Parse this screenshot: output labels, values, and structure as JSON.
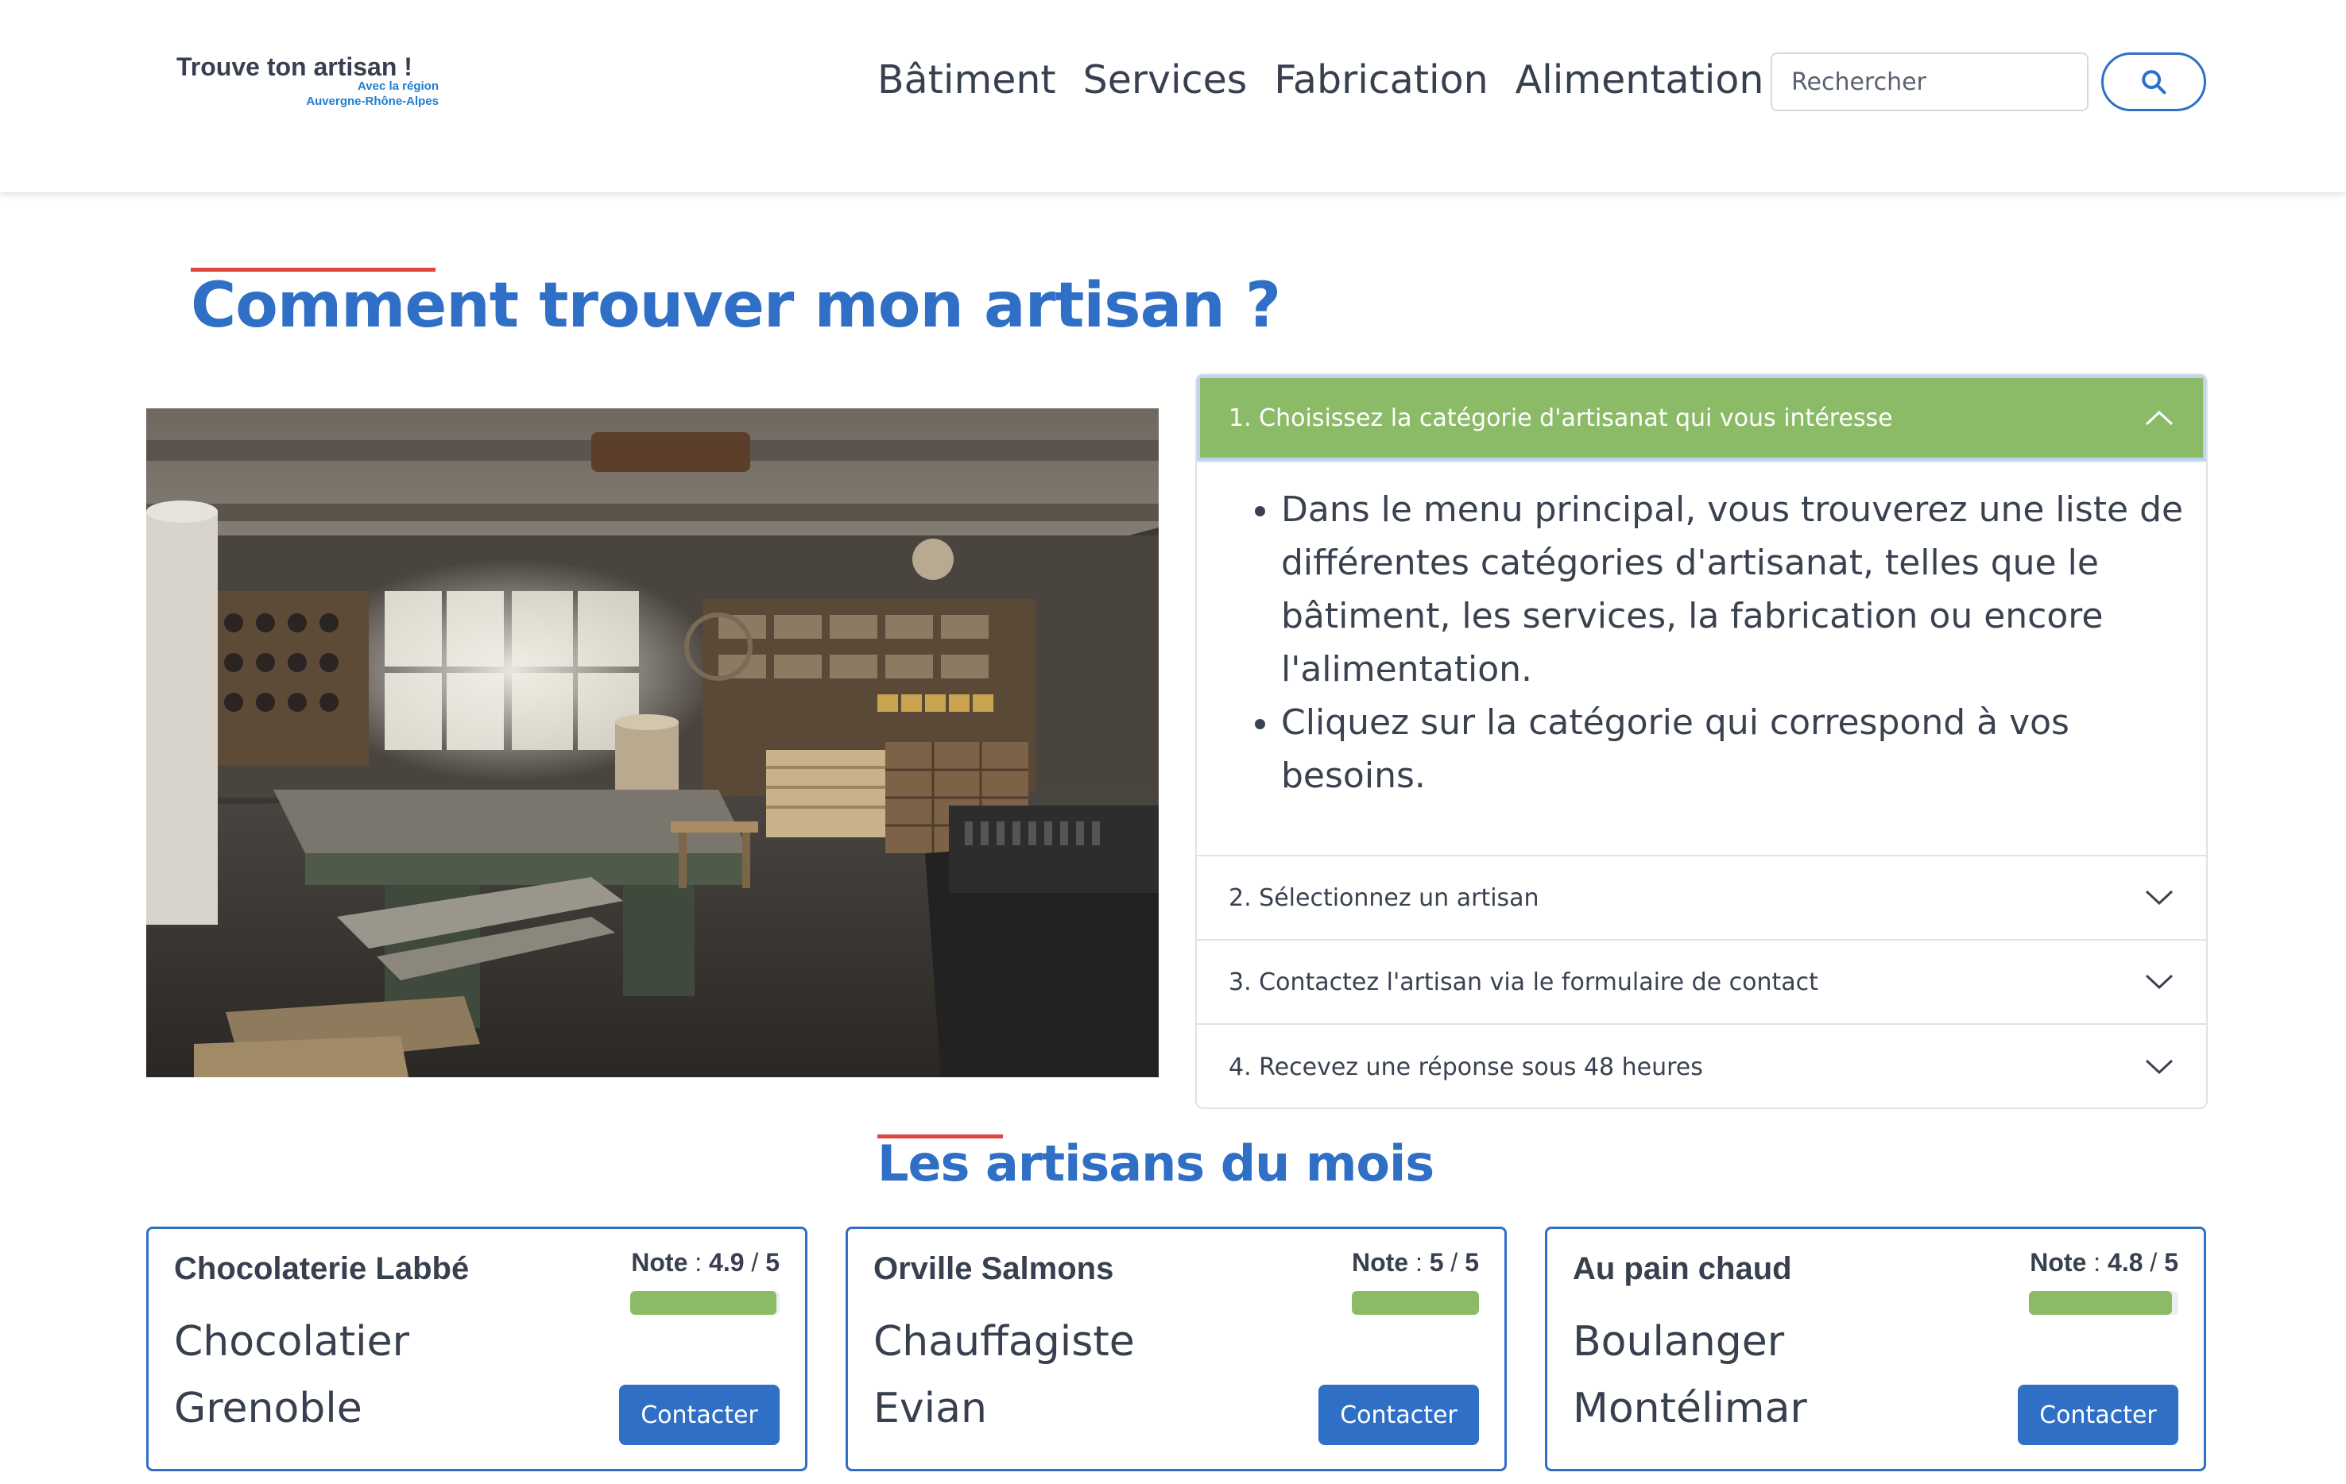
{
  "brand": {
    "title": "Trouve ton artisan !",
    "subtitle_line1": "Avec la région",
    "subtitle_line2": "Auvergne-Rhône-Alpes"
  },
  "nav": {
    "items": [
      "Bâtiment",
      "Services",
      "Fabrication",
      "Alimentation"
    ]
  },
  "search": {
    "placeholder": "Rechercher",
    "value": ""
  },
  "how_to": {
    "title": "Comment trouver mon artisan ?",
    "steps": [
      {
        "label": "1. Choisissez la catégorie d'artisanat qui vous intéresse",
        "expanded": true,
        "bullets": [
          "Dans le menu principal, vous trouverez une liste de différentes catégories d'artisanat, telles que le bâtiment, les services, la fabrication ou encore l'alimentation.",
          "Cliquez sur la catégorie qui correspond à vos besoins."
        ]
      },
      {
        "label": "2. Sélectionnez un artisan",
        "expanded": false
      },
      {
        "label": "3. Contactez l'artisan via le formulaire de contact",
        "expanded": false
      },
      {
        "label": "4. Recevez une réponse sous 48 heures",
        "expanded": false
      }
    ]
  },
  "artisans": {
    "title": "Les artisans du mois",
    "note_label": "Note",
    "contact_label": "Contacter",
    "cards": [
      {
        "name": "Chocolaterie Labbé",
        "job": "Chocolatier",
        "city": "Grenoble",
        "rating": "4.9",
        "rating_max": "5",
        "rating_fraction": 0.98
      },
      {
        "name": "Orville Salmons",
        "job": "Chauffagiste",
        "city": "Evian",
        "rating": "5",
        "rating_max": "5",
        "rating_fraction": 1.0
      },
      {
        "name": "Au pain chaud",
        "job": "Boulanger",
        "city": "Montélimar",
        "rating": "4.8",
        "rating_max": "5",
        "rating_fraction": 0.96
      }
    ]
  },
  "colors": {
    "accent_blue": "#2f6fc6",
    "accent_red": "#e2453d",
    "accordion_active_green": "#8cbb68",
    "rating_green": "#8cbb68"
  },
  "icons": {
    "search": "search-icon",
    "accordion_open": "chevron-up-icon",
    "accordion_closed": "chevron-down-icon"
  }
}
